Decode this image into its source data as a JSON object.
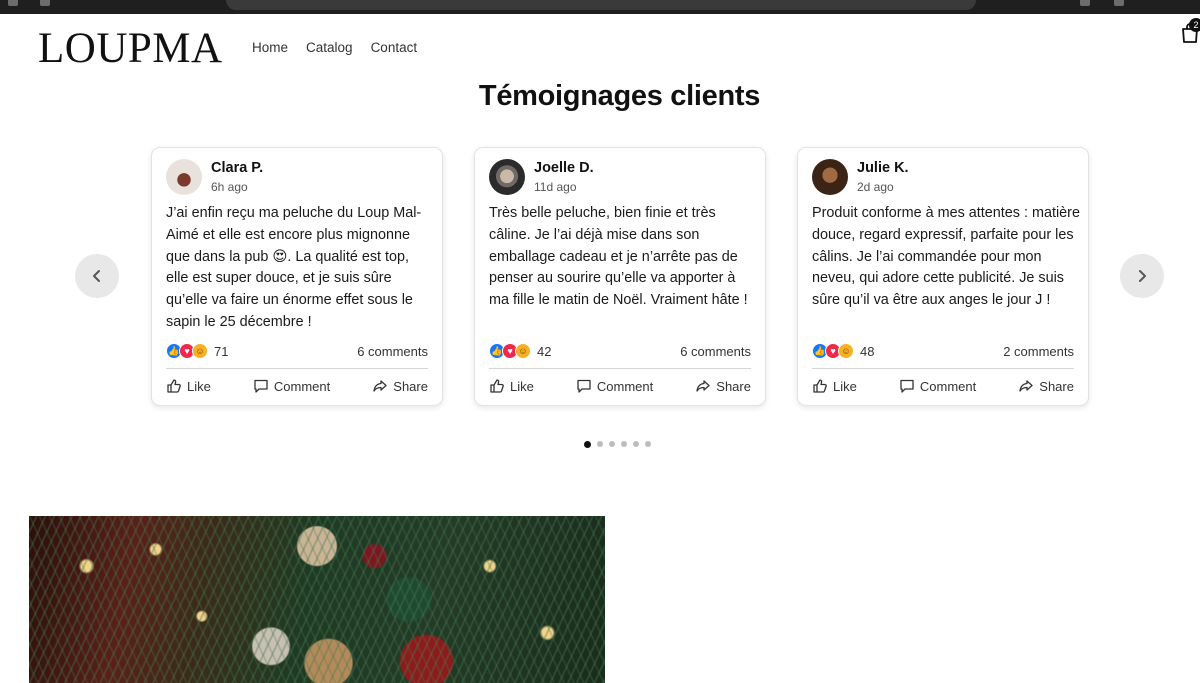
{
  "site": {
    "logo": "LOUPMA",
    "nav": [
      "Home",
      "Catalog",
      "Contact"
    ],
    "cart_count": "2"
  },
  "section": {
    "title": "Témoignages clients"
  },
  "reviews": [
    {
      "author": "Clara P.",
      "time": "6h ago",
      "text": "J’ai enfin reçu ma peluche du Loup Mal-Aimé et elle est encore plus mignonne que dans la pub 😍. La qualité est top, elle est super douce, et je suis sûre qu’elle va faire un énorme effet sous le sapin le 25 décembre !",
      "reactions": "71",
      "comments": "6 comments"
    },
    {
      "author": "Joelle D.",
      "time": "11d ago",
      "text": "Très belle peluche, bien finie et très câline. Je l’ai déjà mise dans son emballage cadeau et je n’arrête pas de penser au sourire qu’elle va apporter à ma fille le matin de Noël. Vraiment hâte !",
      "reactions": "42",
      "comments": "6 comments"
    },
    {
      "author": "Julie K.",
      "time": "2d ago",
      "text": "Produit conforme à mes attentes : matière douce, regard expressif, parfaite pour les câlins. Je l’ai commandée pour mon neveu, qui adore cette publicité. Je suis sûre qu’il va être aux anges le jour J !",
      "reactions": "48",
      "comments": "2 comments"
    }
  ],
  "actions": {
    "like": "Like",
    "comment": "Comment",
    "share": "Share"
  },
  "carousel": {
    "pages": 6,
    "active_page": 1
  },
  "icons": {
    "prev": "chevron-left-icon",
    "next": "chevron-right-icon",
    "cart": "shopping-bag-icon"
  },
  "colors": {
    "like_blue": "#1877f2",
    "love_red": "#f02849",
    "care_yellow": "#f7b125"
  }
}
